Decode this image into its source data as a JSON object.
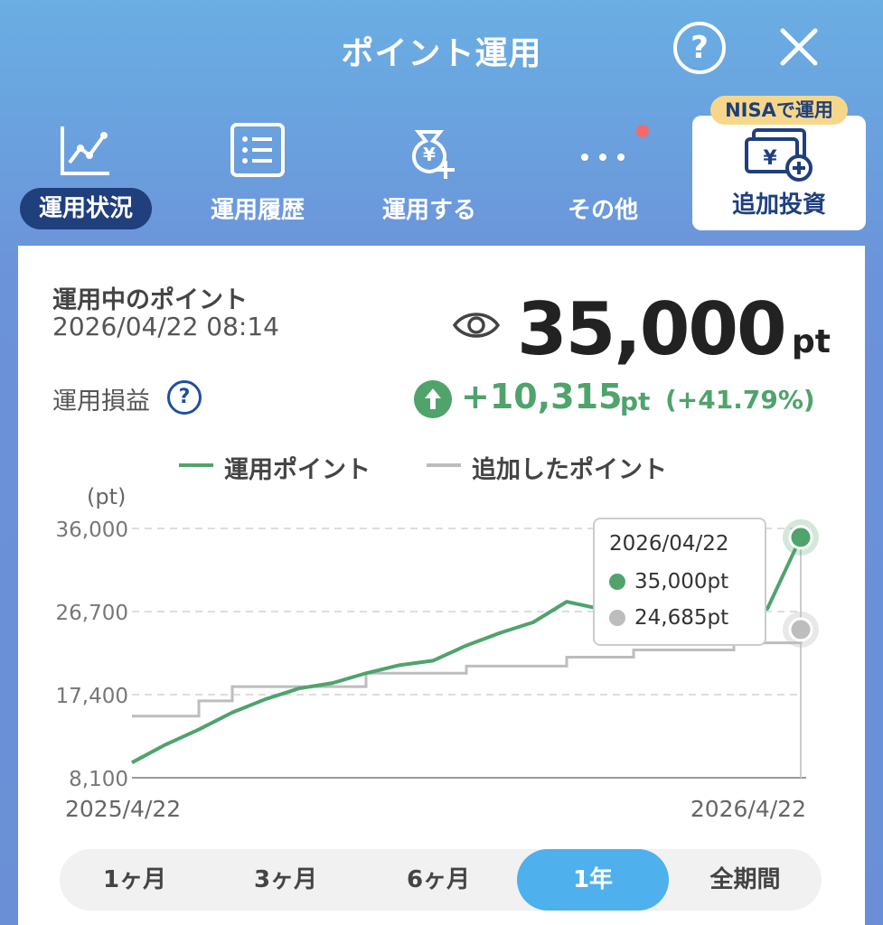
{
  "header": {
    "title": "ポイント運用",
    "help_label": "?"
  },
  "nav": [
    {
      "label": "運用状況",
      "icon": "line-chart-icon",
      "active": true
    },
    {
      "label": "運用履歴",
      "icon": "list-icon",
      "active": false
    },
    {
      "label": "運用する",
      "icon": "yen-bag-plus-icon",
      "active": false
    },
    {
      "label": "その他",
      "icon": "more-icon",
      "active": false
    }
  ],
  "invest": {
    "badge": "NISAで運用",
    "label": "追加投資",
    "icon": "yen-wallet-plus-icon"
  },
  "summary": {
    "label": "運用中のポイント",
    "date": "2026/04/22 08:14",
    "value": "35,000",
    "unit": "pt",
    "pnl_label": "運用損益",
    "pnl_help": "?",
    "pnl_value": "+10,315",
    "pnl_unit": "pt",
    "pnl_pct": "(+41.79%)"
  },
  "legend": {
    "series1": "運用ポイント",
    "series2": "追加したポイント"
  },
  "tooltip": {
    "date": "2026/04/22",
    "value1": "35,000pt",
    "value2": "24,685pt"
  },
  "periods": [
    "1ヶ月",
    "3ヶ月",
    "6ヶ月",
    "1年",
    "全期間"
  ],
  "colors": {
    "green": "#4fa36b",
    "gray": "#bdbdbd",
    "accent": "#4eb0ec",
    "navy": "#1f3f7d"
  },
  "chart_data": {
    "type": "line",
    "ylabel": "(pt)",
    "yticks": [
      "36,000",
      "26,700",
      "17,400",
      "8,100"
    ],
    "ylim": [
      8100,
      36000
    ],
    "xticks": [
      "2025/4/22",
      "2026/4/22"
    ],
    "x": [
      0,
      5,
      10,
      15,
      20,
      25,
      30,
      35,
      40,
      45,
      50,
      55,
      60,
      65,
      70,
      75,
      80,
      85,
      90,
      95,
      100
    ],
    "series": [
      {
        "name": "運用ポイント",
        "color": "#4fa36b",
        "values": [
          9800,
          11800,
          13500,
          15400,
          16900,
          18100,
          18700,
          19800,
          20700,
          21200,
          22900,
          24300,
          25500,
          27800,
          27000,
          28800,
          29800,
          30200,
          29600,
          27000,
          35000
        ]
      },
      {
        "name": "追加したポイント",
        "color": "#bdbdbd",
        "values": [
          15000,
          15000,
          16700,
          18300,
          18300,
          18300,
          18300,
          19800,
          19800,
          19800,
          20600,
          20600,
          20600,
          21600,
          21600,
          22400,
          22400,
          22400,
          23200,
          23200,
          24685
        ]
      }
    ],
    "grid": "dashed horizontal",
    "legend": "top"
  }
}
